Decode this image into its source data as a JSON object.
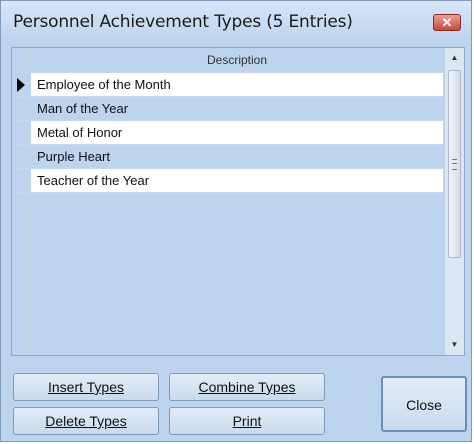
{
  "window": {
    "title": "Personnel Achievement Types (5 Entries)",
    "close_glyph": "✕"
  },
  "grid": {
    "header": "Description",
    "rows": [
      {
        "label": "Employee of the Month",
        "selected": true
      },
      {
        "label": "Man of the Year"
      },
      {
        "label": "Metal of Honor"
      },
      {
        "label": "Purple Heart"
      },
      {
        "label": "Teacher of the Year"
      }
    ],
    "scroll_up": "▲",
    "scroll_down": "▼"
  },
  "buttons": {
    "insert": "Insert Types",
    "combine": "Combine Types",
    "delete": "Delete Types",
    "print": "Print",
    "close": "Close"
  },
  "colors": {
    "background": "#bcd4ee",
    "row_white": "#ffffff",
    "row_alt": "#bcd4ee",
    "close_red": "#c8483a"
  },
  "icons": {
    "row_indicator": "right-triangle-icon",
    "window_close": "close-icon"
  }
}
